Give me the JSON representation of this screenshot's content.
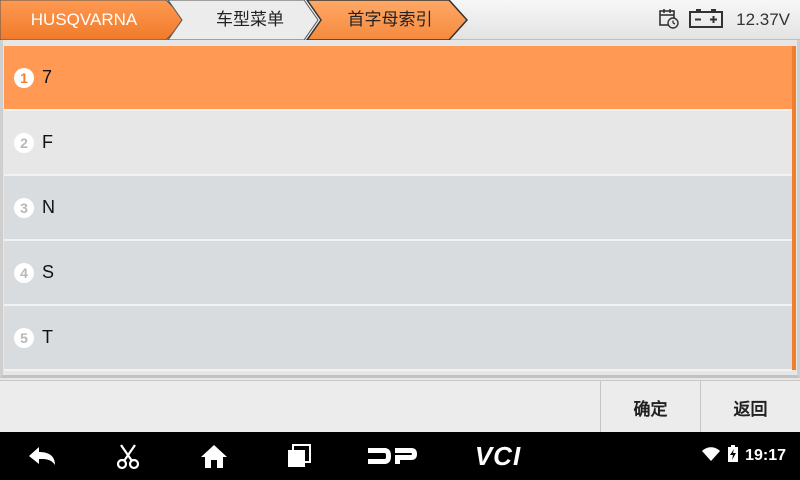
{
  "header": {
    "breadcrumbs": [
      {
        "label": "HUSQVARNA"
      },
      {
        "label": "车型菜单"
      },
      {
        "label": "首字母索引"
      }
    ],
    "battery_voltage": "12.37V"
  },
  "list": {
    "items": [
      {
        "number": "1",
        "label": "7",
        "selected": true
      },
      {
        "number": "2",
        "label": "F"
      },
      {
        "number": "3",
        "label": "N"
      },
      {
        "number": "4",
        "label": "S"
      },
      {
        "number": "5",
        "label": "T"
      }
    ]
  },
  "actions": {
    "confirm_label": "确定",
    "back_label": "返回"
  },
  "nav_bar": {
    "clock": "19:17",
    "dp_label": "DP",
    "vci_label": "VCI"
  },
  "colors": {
    "accent": "#f07e2f",
    "selected_row": "#ff9954",
    "row_a": "#e7e7e7",
    "row_b": "#d8dcdf"
  }
}
